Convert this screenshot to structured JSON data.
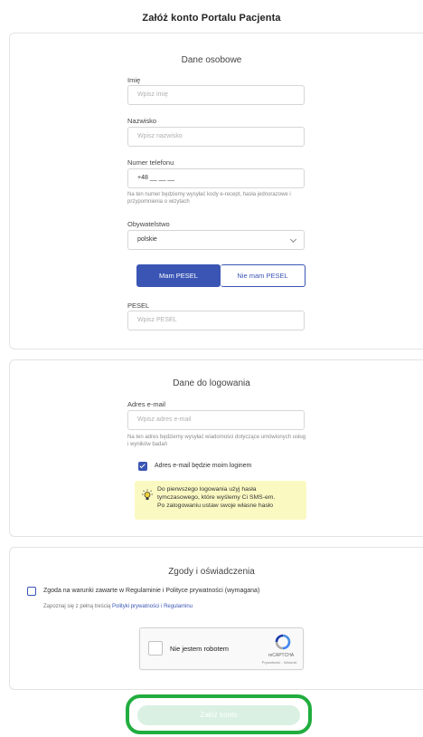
{
  "page": {
    "title": "Załóż konto Portalu Pacjenta"
  },
  "personal": {
    "title": "Dane osobowe",
    "first_name": {
      "label": "Imię",
      "placeholder": "Wpisz imię"
    },
    "last_name": {
      "label": "Nazwisko",
      "placeholder": "Wpisz nazwisko"
    },
    "phone": {
      "label": "Numer telefonu",
      "value": "+48 __ __ __",
      "hint": "Na ten numer będziemy wysyłać kody e-recept, hasła jednorazowe i przypomnienia o wizytach"
    },
    "citizenship": {
      "label": "Obywatelstwo",
      "value": "polskie"
    },
    "pesel_toggle": {
      "on_label": "Mam PESEL",
      "off_label": "Nie mam PESEL"
    },
    "pesel": {
      "label": "PESEL",
      "placeholder": "Wpisz PESEL"
    }
  },
  "login": {
    "title": "Dane do logowania",
    "email": {
      "label": "Adres e-mail",
      "placeholder": "Wpisz adres e-mail",
      "hint": "Na ten adres będziemy wysyłać wiadomości dotyczące umówionych usług i wyników badań"
    },
    "email_login_checkbox": {
      "label": "Adres e-mail będzie moim loginem",
      "checked": true
    },
    "note": {
      "line1": "Do pierwszego logowania użyj hasła",
      "line2": "tymczasowego, które wyślemy Ci SMS-em.",
      "line3": "Po zalogowaniu ustaw swoje własne hasło",
      "icon": "lightbulb-icon"
    }
  },
  "consent": {
    "title": "Zgody i oświadczenia",
    "terms_checkbox": {
      "label": "Zgoda na warunki zawarte w Regulaminie i Polityce prywatności (wymagana)",
      "checked": false
    },
    "sub_text": "Zapoznaj się z pełną treścią",
    "sub_link": "Polityki prywatności i Regulaminu",
    "captcha": {
      "label": "Nie jestem robotem",
      "brand": "reCAPTCHA",
      "links": "Prywatność - Warunki"
    }
  },
  "submit": {
    "label": "Załóż konto"
  },
  "colors": {
    "accent": "#3a55b4",
    "highlight_border": "#21ad3f",
    "submit_disabled": "#d9f0e2",
    "note_bg": "#fbf9c2"
  }
}
